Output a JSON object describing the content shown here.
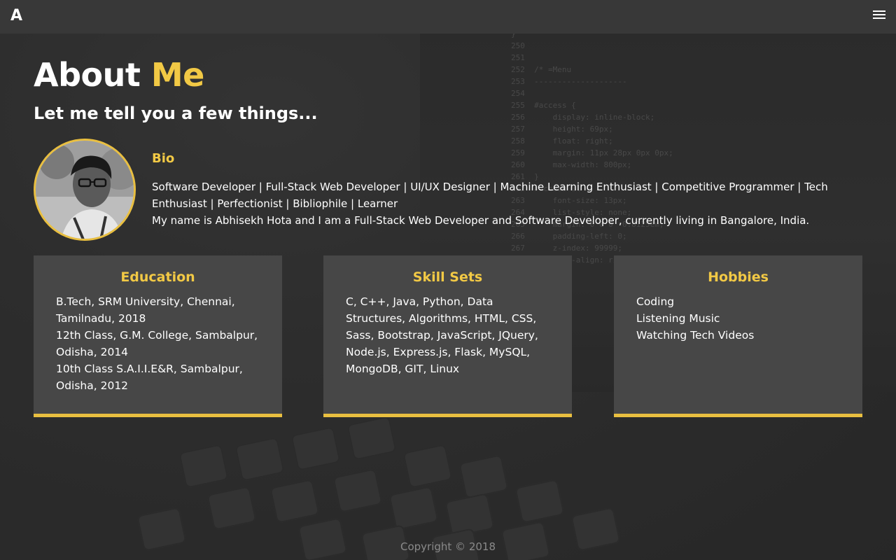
{
  "navbar": {
    "brand": "A"
  },
  "header": {
    "title_main": "About",
    "title_accent": "Me",
    "subtitle": "Let me tell you a few things..."
  },
  "bio": {
    "title": "Bio",
    "tagline": "Software Developer | Full-Stack Web Developer | UI/UX Designer | Machine Learning Enthusiast | Competitive Programmer | Tech Enthusiast | Perfectionist | Bibliophile | Learner",
    "description": "My name is Abhisekh Hota and I am a Full-Stack Web Developer and Software Developer, currently living in Bangalore, India."
  },
  "cards": [
    {
      "title": "Education",
      "lines": [
        "B.Tech, SRM University, Chennai, Tamilnadu, 2018",
        "12th Class, G.M. College, Sambalpur, Odisha, 2014",
        "10th Class S.A.I.I.E&R, Sambalpur, Odisha, 2012"
      ]
    },
    {
      "title": "Skill Sets",
      "lines": [
        "C, C++, Java, Python, Data Structures, Algorithms, HTML, CSS, Sass, Bootstrap, JavaScript, JQuery, Node.js, Express.js, Flask, MySQL, MongoDB, GIT, Linux"
      ]
    },
    {
      "title": "Hobbies",
      "lines": [
        "Coding",
        "Listening Music",
        "Watching Tech Videos"
      ]
    }
  ],
  "footer": {
    "text": "Copyright © 2018"
  },
  "colors": {
    "accent": "#f2c945",
    "card_bg": "#474747",
    "navbar_bg": "#383838"
  },
  "icons": {
    "menu": "hamburger-icon"
  }
}
